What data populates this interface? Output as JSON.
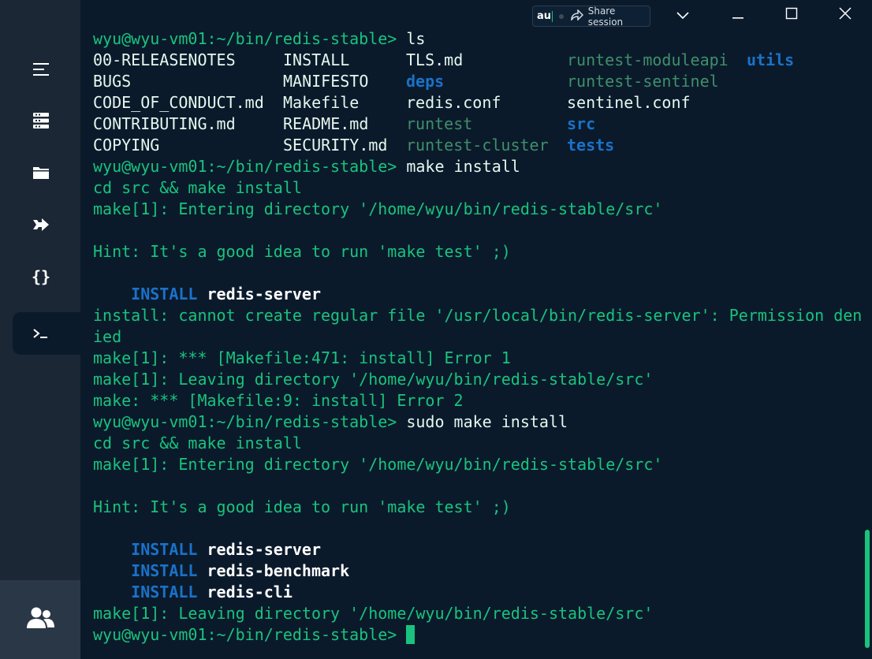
{
  "topbar": {
    "ime_text": "au",
    "share_label": "Share session"
  },
  "sidebar": {
    "items": [
      {
        "icon": "menu-icon"
      },
      {
        "icon": "hosts-icon"
      },
      {
        "icon": "folder-icon"
      },
      {
        "icon": "port-forward-icon"
      },
      {
        "icon": "snippets-icon"
      },
      {
        "icon": "terminal-icon",
        "active": true
      }
    ],
    "bottom_icon": "team-icon"
  },
  "terminal": {
    "prompt": "wyu@wyu-vm01:~/bin/redis-stable>",
    "cmd_ls": " ls",
    "ls_rows": [
      [
        "00-RELEASENOTES",
        "INSTALL",
        "TLS.md",
        "runtest-moduleapi",
        "utils"
      ],
      [
        "BUGS",
        "MANIFESTO",
        "deps",
        "runtest-sentinel",
        ""
      ],
      [
        "CODE_OF_CONDUCT.md",
        "Makefile",
        "redis.conf",
        "sentinel.conf",
        ""
      ],
      [
        "CONTRIBUTING.md",
        "README.md",
        "runtest",
        "src",
        ""
      ],
      [
        "COPYING",
        "SECURITY.md",
        "runtest-cluster",
        "tests",
        ""
      ]
    ],
    "cmd_make": " make install",
    "out_cd": "cd src && make install",
    "out_enter": "make[1]: Entering directory '/home/wyu/bin/redis-stable/src'",
    "out_hint": "Hint: It's a good idea to run 'make test' ;)",
    "install_kw": "INSTALL",
    "target_server": "redis-server",
    "target_benchmark": "redis-benchmark",
    "target_cli": "redis-cli",
    "err_1": "install: cannot create regular file '/usr/local/bin/redis-server': Permission den",
    "err_2": "ied",
    "err_3": "make[1]: *** [Makefile:471: install] Error 1",
    "out_leave": "make[1]: Leaving directory '/home/wyu/bin/redis-stable/src'",
    "err_4": "make: *** [Makefile:9: install] Error 2",
    "cmd_sudo": " sudo make install"
  },
  "colors": {
    "background": "#0b1a2b",
    "text_green": "#19c37d",
    "directory_blue": "#1a72c9",
    "sidebar": "#1b2735"
  }
}
